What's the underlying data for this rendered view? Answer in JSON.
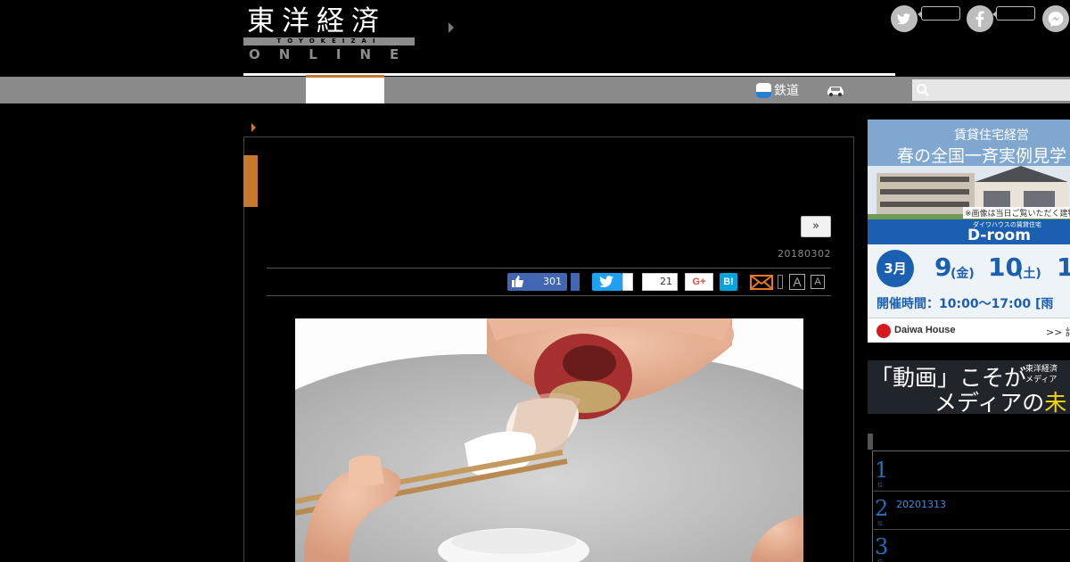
{
  "header": {
    "logo_kanji": "東洋経済",
    "logo_sub": "TOYOKEIZAI",
    "logo_online": "ONLINE"
  },
  "nav": {
    "rail_label": "鉄道",
    "search_placeholder": ""
  },
  "article": {
    "next_label": "»",
    "date": "20180302",
    "share": {
      "like_count": "301",
      "pocket_count": "21",
      "gplus_label": "G+",
      "hatena_label": "B!",
      "font_large_label": "A",
      "font_small_label": "A"
    }
  },
  "sidebar": {
    "ad1": {
      "title1": "賃貸住宅経営",
      "title2": "春の全国一斉実例見学",
      "caption": "※画像は当日ご覧いただく建物",
      "brand": "ダイワハウスの賃貸住宅",
      "product": "D-room",
      "month": "3月",
      "day1": "9",
      "dow1": "(金)",
      "day2": "10",
      "dow2": "(土)",
      "day3": "1",
      "hours": "開催時間：10:00〜17:00 [雨",
      "company": "Daiwa House",
      "more": ">> 詳"
    },
    "ad2": {
      "line1_pre": "「動画」",
      "line1_post": "こそが",
      "line2_pre": "メディアの",
      "line2_hl": "未",
      "side1": "東洋経済",
      "side2": "メディア"
    },
    "ranking": [
      {
        "num": "1",
        "sub": "位",
        "text": ""
      },
      {
        "num": "2",
        "sub": "位",
        "text": "20201313"
      },
      {
        "num": "3",
        "sub": "位",
        "text": ""
      }
    ]
  }
}
